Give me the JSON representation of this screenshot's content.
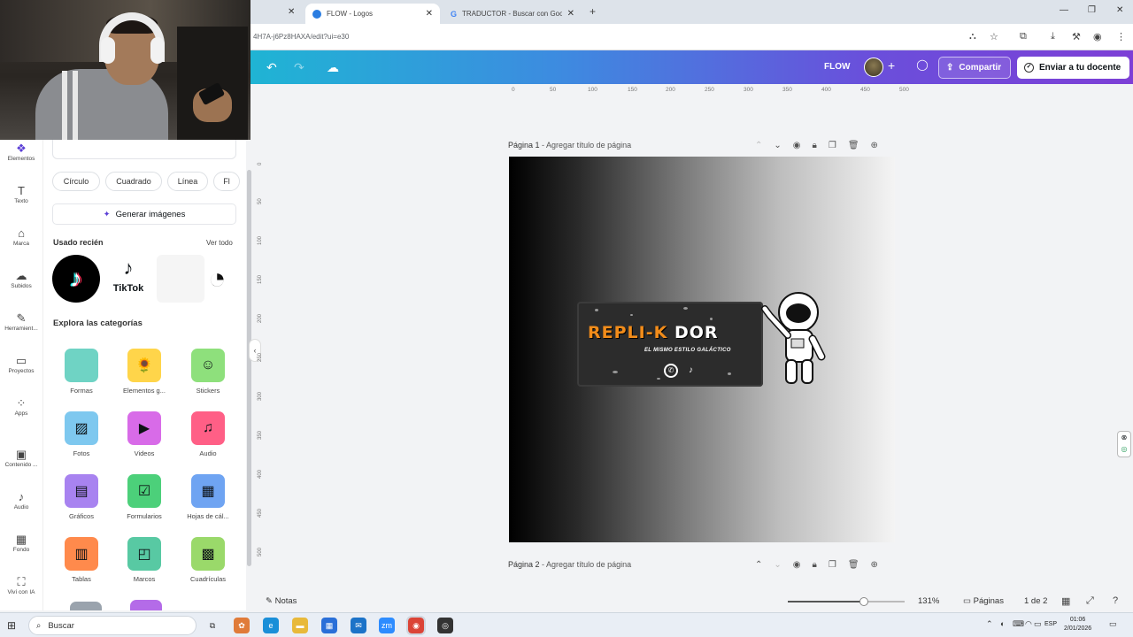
{
  "browser": {
    "tabs": [
      {
        "label": "FLOW - Logos",
        "active": true
      },
      {
        "label": "TRADUCTOR - Buscar con Goo",
        "active": false
      }
    ],
    "url": "4H7A-j6Pz8HAXA/edit?ui=e30"
  },
  "header": {
    "project_name": "FLOW",
    "share_label": "Compartir",
    "send_label": "Enviar a tu docente"
  },
  "rail": {
    "items": [
      {
        "label": "Elementos",
        "icon": "elements-icon"
      },
      {
        "label": "Texto",
        "icon": "text-icon"
      },
      {
        "label": "Marca",
        "icon": "brand-icon"
      },
      {
        "label": "Subidos",
        "icon": "upload-icon"
      },
      {
        "label": "Herramient...",
        "icon": "tools-icon"
      },
      {
        "label": "Proyectos",
        "icon": "folder-icon"
      },
      {
        "label": "Apps",
        "icon": "apps-icon"
      },
      {
        "label": "Contenido ...",
        "icon": "content-icon"
      },
      {
        "label": "Audio",
        "icon": "audio-icon"
      },
      {
        "label": "Fondo",
        "icon": "background-icon"
      },
      {
        "label": "Viví con IA",
        "icon": "ai-icon"
      }
    ]
  },
  "panel": {
    "chips": [
      "Círculo",
      "Cuadrado",
      "Línea",
      "Fl"
    ],
    "generate_label": "Generar imágenes",
    "recent_title": "Usado recién",
    "see_all": "Ver todo",
    "recent_labels": [
      "TikTok"
    ],
    "explore_title": "Explora las categorías",
    "categories": [
      {
        "label": "Formas",
        "color": "#6fd3c4"
      },
      {
        "label": "Elementos g...",
        "color": "#ffd54a"
      },
      {
        "label": "Stickers",
        "color": "#8ee07c"
      },
      {
        "label": "Fotos",
        "color": "#7ec8ef"
      },
      {
        "label": "Videos",
        "color": "#d86be8"
      },
      {
        "label": "Audio",
        "color": "#ff5f86"
      },
      {
        "label": "Gráficos",
        "color": "#a883f0"
      },
      {
        "label": "Formularios",
        "color": "#4cd07a"
      },
      {
        "label": "Hojas de cál...",
        "color": "#6fa4f2"
      },
      {
        "label": "Tablas",
        "color": "#ff8a4c"
      },
      {
        "label": "Marcos",
        "color": "#58c9a3"
      },
      {
        "label": "Cuadrículas",
        "color": "#9ad96a"
      }
    ]
  },
  "rulers": {
    "top": [
      "0",
      "50",
      "100",
      "150",
      "200",
      "250",
      "300",
      "350",
      "400",
      "450",
      "500"
    ],
    "left": [
      "0",
      "50",
      "100",
      "150",
      "200",
      "250",
      "300",
      "350",
      "400",
      "450",
      "500"
    ]
  },
  "canvas": {
    "page1_label": "Página 1",
    "page1_placeholder": "- Agregar título de página",
    "page2_label": "Página 2",
    "page2_placeholder": "- Agregar título de página",
    "logo_word1": "REPLI-K",
    "logo_word2": " DOR",
    "logo_tagline": "EL MISMO ESTILO GALÁCTICO"
  },
  "footer": {
    "notes_label": "Notas",
    "zoom": "131%",
    "zoom_level": 0.65,
    "pages_label": "Páginas",
    "page_count": "1 de 2"
  },
  "taskbar": {
    "search_placeholder": "Buscar",
    "language": "ESP",
    "time": "01:06",
    "date": "2/01/2026"
  }
}
